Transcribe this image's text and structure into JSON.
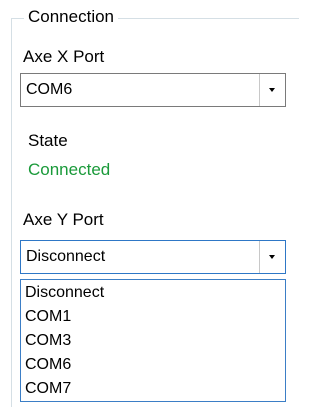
{
  "connection_group": {
    "title": "Connection"
  },
  "axe_x": {
    "label": "Axe X Port",
    "selected": "COM6"
  },
  "state": {
    "label": "State",
    "value": "Connected",
    "value_color": "#1a9a3a"
  },
  "axe_y": {
    "label": "Axe Y Port",
    "selected": "Disconnect",
    "options": [
      "Disconnect",
      "COM1",
      "COM3",
      "COM6",
      "COM7"
    ]
  },
  "icons": {
    "dropdown_arrow": "chevron-down-icon"
  }
}
